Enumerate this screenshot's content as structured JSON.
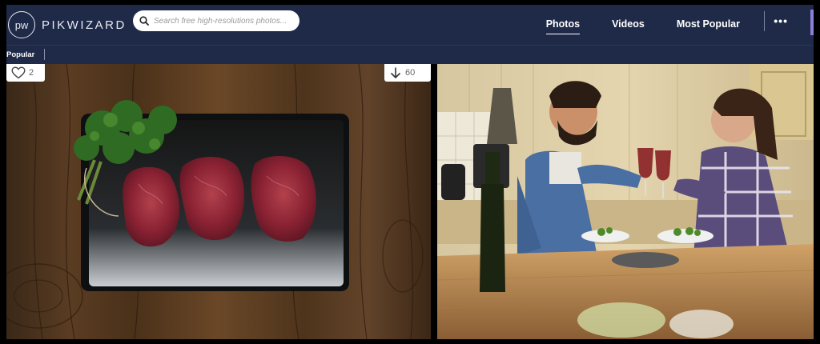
{
  "header": {
    "logo_mark": "pw",
    "logo_text": "PIKWIZARD",
    "search_placeholder": "Search free high-resolutions photos...",
    "nav": [
      {
        "label": "Photos",
        "active": true
      },
      {
        "label": "Videos",
        "active": false
      },
      {
        "label": "Most Popular",
        "active": false
      }
    ],
    "more_label": "•••"
  },
  "subnav": {
    "label": "Popular"
  },
  "photos": [
    {
      "id": "meat",
      "likes": "2",
      "downloads": "60"
    },
    {
      "id": "couple",
      "likes": null,
      "downloads": null
    }
  ],
  "colors": {
    "header_bg": "#1f2a48",
    "accent": "#8b7fd6"
  },
  "icons": {
    "logo": "pw-circle-logo",
    "search": "search-icon",
    "like": "heart-icon",
    "download": "download-arrow-icon",
    "more": "more-dots-icon"
  }
}
